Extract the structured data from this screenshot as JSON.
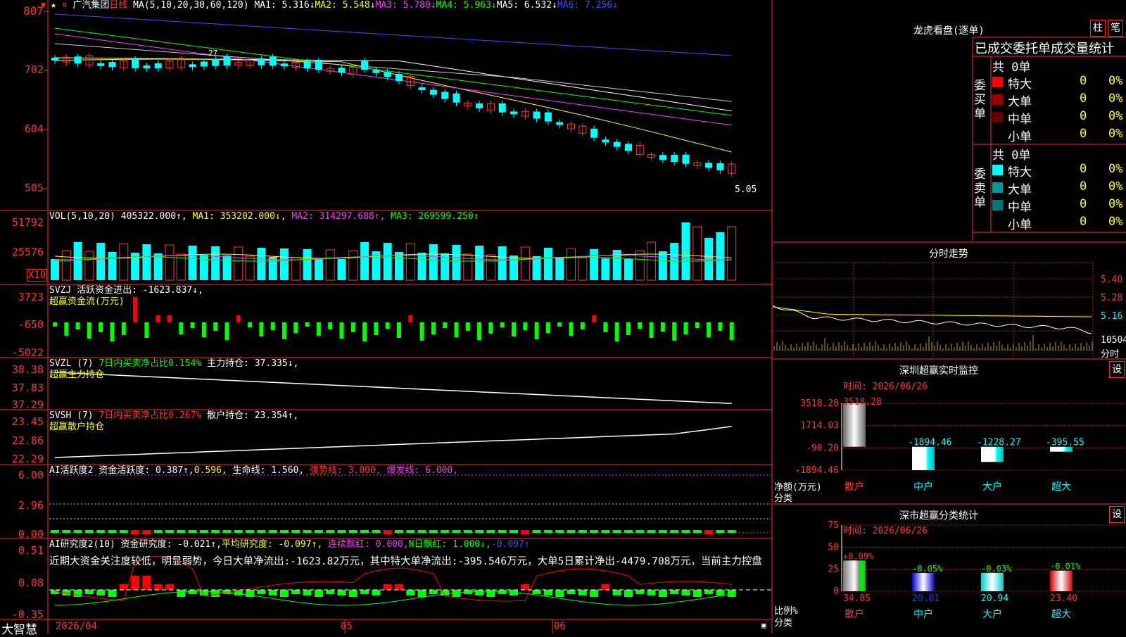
{
  "header": {
    "stock_name": "广汽集团",
    "period": "日线",
    "ma_title": "MA(5,10,20,30,60,120)",
    "ma1": "MA1: 5.316↓",
    "ma2": "MA2: 5.548↓",
    "ma3": "MA3: 5.780↓",
    "ma4": "MA4: 5.963↓",
    "ma5": "MA5: 6.532↓",
    "ma6": "MA6: 7.256↓"
  },
  "price_axis": [
    "807",
    "702",
    "604",
    "505"
  ],
  "price_annotations": {
    "high_mark": "27",
    "last_price": "5.05"
  },
  "vol": {
    "title": "VOL(5,10,20)",
    "value": "405322.000↑,",
    "ma1": "MA1: 353202.000↓,",
    "ma2": "MA2: 314297.688↑,",
    "ma3": "MA3: 269599.250↑",
    "axis": [
      "51792",
      "25576"
    ],
    "unit": "X10"
  },
  "svzj": {
    "title": "SVZJ  活跃资金进出: -1623.837↓,",
    "subtitle": "超赢资金流(万元)",
    "axis": [
      "3723",
      "-650",
      "-5022"
    ]
  },
  "svzl": {
    "title": "SVZL (7)",
    "text1": "7日内买卖净占比0.154%",
    "text2": "主力持仓: 37.335↓,",
    "subtitle": "超赢主力持仓",
    "axis": [
      "38.38",
      "37.83",
      "37.29"
    ]
  },
  "svsh": {
    "title": "SVSH (7)",
    "text1": "7日内买卖净占比0.267%",
    "text2": "散户持仓: 23.354↑,",
    "subtitle": "超赢散户持仓",
    "axis": [
      "23.45",
      "22.86",
      "22.29"
    ]
  },
  "ai_active": {
    "title": "AI活跃度2",
    "t1": "资金活跃度: 0.387↑,",
    "t2": "0.596,",
    "t3": "生命线: 1.560,",
    "t4": "强势线: 3.000,",
    "t5": "爆发线: 6.000,",
    "axis": [
      "6.00",
      "2.96",
      "0.00"
    ]
  },
  "ai_research": {
    "title": "AI研究度2(10)",
    "t1": "资金研究度: -0.021↑,",
    "t2": "平均研究度: -0.097↑,",
    "t3": "连续飘红: 0.000,",
    "t4": "N日飘红: 1.000↓,",
    "t5": "-0.097↑",
    "description": "近期大资金关注度较低，明显弱势，今日大单净流出:-1623.82万元，其中特大单净流出:-395.546万元，大单5日累计净出-4479.708万元，当前主力控盘",
    "axis": [
      "0.51",
      "0.08",
      "-0.35"
    ]
  },
  "bottom_axis": {
    "app_name": "大智慧",
    "dates": [
      "2026/04",
      "05",
      "06"
    ]
  },
  "dragon": {
    "title": "龙虎看盘(逐单)",
    "tab_bar": "柱",
    "tab_note": "笔",
    "subtitle": "已成交委托单成交量统计",
    "buy_label": "委买单",
    "sell_label": "委卖单",
    "buy_total": "共 0单",
    "sell_total": "共 0单",
    "buy_rows": [
      {
        "label": "特大",
        "count": "0",
        "pct": "0%",
        "color": "#ff0000"
      },
      {
        "label": "大单",
        "count": "0",
        "pct": "0%",
        "color": "#990000"
      },
      {
        "label": "中单",
        "count": "0",
        "pct": "0%",
        "color": "#660000"
      },
      {
        "label": "小单",
        "count": "0",
        "pct": "0%",
        "color": ""
      }
    ],
    "sell_rows": [
      {
        "label": "特大",
        "count": "0",
        "pct": "0%",
        "color": "#00ffff"
      },
      {
        "label": "大单",
        "count": "0",
        "pct": "0%",
        "color": "#009999"
      },
      {
        "label": "中单",
        "count": "0",
        "pct": "0%",
        "color": "#007777"
      },
      {
        "label": "小单",
        "count": "0",
        "pct": "0%",
        "color": ""
      }
    ]
  },
  "intraday": {
    "title": "分时走势",
    "axis": [
      "5.40",
      "5.28",
      "5.16"
    ],
    "vol_label": "10504",
    "time_label": "分时"
  },
  "monitor": {
    "title": "深圳超赢实时监控",
    "settings": "设",
    "time": "时间: 2026/06/26",
    "axis": [
      "3518.28",
      "1714.03",
      "-90.20",
      "-1894.46"
    ],
    "ylabel": "净额(万元)",
    "xlabel": "分类"
  },
  "category": {
    "title": "深市超赢分类统计",
    "settings": "设",
    "time": "时间: 2026/06/26",
    "axis": [
      "75",
      "50",
      "25",
      "0"
    ],
    "ylabel": "比例%",
    "xlabel": "分类"
  },
  "chart_data": [
    {
      "type": "bar",
      "title": "深圳超赢实时监控",
      "ylabel": "净额(万元)",
      "xlabel": "分类",
      "categories": [
        "散户",
        "中户",
        "大户",
        "超大"
      ],
      "values": [
        3518.28,
        -1894.46,
        -1228.27,
        -395.55
      ],
      "value_labels": [
        "3518.28",
        "-1894.46",
        "-1228.27",
        "-395.55"
      ],
      "ylim": [
        -1894.46,
        3518.28
      ]
    },
    {
      "type": "bar",
      "title": "深市超赢分类统计",
      "ylabel": "比例%",
      "xlabel": "分类",
      "categories": [
        "散户",
        "中户",
        "大户",
        "超大"
      ],
      "values": [
        34.85,
        20.81,
        20.94,
        23.4
      ],
      "value_labels": [
        "34.85",
        "20.81",
        "20.94",
        "23.40"
      ],
      "change_labels": [
        "+0.09%",
        "-0.05%",
        "-0.03%",
        "-0.01%"
      ],
      "ylim": [
        0,
        75
      ]
    }
  ]
}
